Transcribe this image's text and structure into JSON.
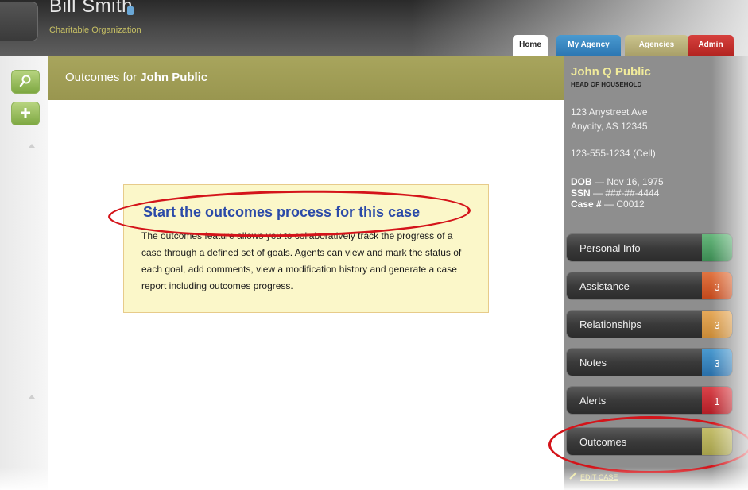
{
  "header": {
    "user_name": "Bill Smith",
    "user_badge": "&nbsp;&nbsp;",
    "organization": "Charitable Organization",
    "tabs": [
      {
        "label": "Home",
        "active": true
      },
      {
        "label": "My Agency",
        "color": "#2c77b3"
      },
      {
        "label": "Agencies",
        "color": "#a9a069"
      },
      {
        "label": "Admin",
        "color": "#b32421"
      }
    ]
  },
  "leftbar": {
    "icons": [
      "search-icon",
      "plus-icon"
    ]
  },
  "main": {
    "title_prefix": "Outcomes for ",
    "title_name": "John Public",
    "callout": {
      "link": "Start the outcomes process for this case",
      "description": "The outcomes feature allows you to collaboratively track the progress of a case through a defined set of goals. Agents can view and mark the status of each goal, add comments, view a modification history and generate a case report including outcomes progress."
    }
  },
  "sidebar": {
    "name": "John Q Public",
    "role": "HEAD OF HOUSEHOLD",
    "address_line1": "123 Anystreet Ave",
    "address_line2": "Anycity, AS  12345",
    "phone": "123-555-1234 (Cell)",
    "dob_label": "DOB",
    "dob_value": " — Nov 16, 1975",
    "ssn_label": "SSN",
    "ssn_value": " — ###-##-4444",
    "case_label": "Case #",
    "case_value": "  —  C0012",
    "menu": [
      {
        "label": "Personal Info",
        "badge": "",
        "color": "#3b8a52"
      },
      {
        "label": "Assistance",
        "badge": "3",
        "color": "#c2481b"
      },
      {
        "label": "Relationships",
        "badge": "3",
        "color": "#c88a37"
      },
      {
        "label": "Notes",
        "badge": "3",
        "color": "#2a6fa8"
      },
      {
        "label": "Alerts",
        "badge": "1",
        "color": "#b21e26"
      },
      {
        "label": "Outcomes",
        "badge": "",
        "color": "#a49f4b"
      }
    ],
    "edit_case": "EDIT CASE"
  },
  "annotations": {
    "highlight_color": "#d4141a"
  }
}
